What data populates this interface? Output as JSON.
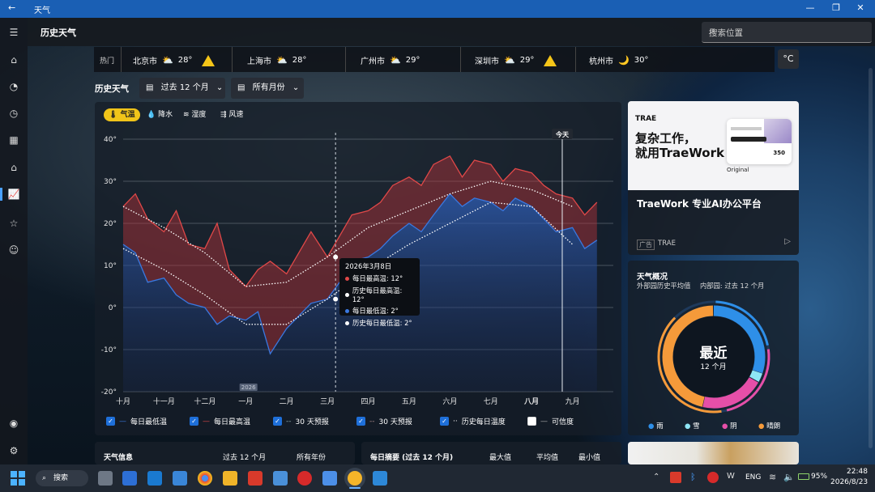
{
  "window": {
    "title": "天气",
    "controls": [
      "—",
      "❐",
      "✕"
    ]
  },
  "app": {
    "title": "历史天气",
    "search_placeholder": "搜索位置",
    "unit": "°C"
  },
  "nav_icons": [
    "menu-icon",
    "home-icon",
    "forecast-icon",
    "history-icon",
    "calendar-icon",
    "map-icon",
    "trend-chart-icon",
    "favorites-icon",
    "smiley-icon",
    "account-icon",
    "settings-icon"
  ],
  "hot_label": "热门",
  "cities": [
    {
      "name": "北京市",
      "temp": "28°",
      "icon": "⛅",
      "warn": true
    },
    {
      "name": "上海市",
      "temp": "28°",
      "icon": "⛅",
      "warn": false
    },
    {
      "name": "广州市",
      "temp": "29°",
      "icon": "⛅",
      "warn": false
    },
    {
      "name": "深圳市",
      "temp": "29°",
      "icon": "⛅",
      "warn": true
    },
    {
      "name": "杭州市",
      "temp": "30°",
      "icon": "🌙",
      "warn": false
    }
  ],
  "section_title": "历史天气",
  "filters": {
    "range": "过去 12 个月",
    "months": "所有月份"
  },
  "metric_tabs": [
    {
      "icon": "🌡",
      "label": "气温",
      "active": true
    },
    {
      "icon": "💧",
      "label": "降水",
      "active": false
    },
    {
      "icon": "≋",
      "label": "湿度",
      "active": false
    },
    {
      "icon": "⇶",
      "label": "风速",
      "active": false
    }
  ],
  "chart_data": {
    "type": "line",
    "yaxis": {
      "min": -20,
      "max": 40,
      "ticks": [
        "40°",
        "30°",
        "20°",
        "10°",
        "0°",
        "-10°",
        "-20°"
      ]
    },
    "x_labels": [
      "十月",
      "十一月",
      "十二月",
      "一月",
      "二月",
      "三月",
      "四月",
      "五月",
      "六月",
      "七月",
      "八月",
      "九月"
    ],
    "year_marker": "2026",
    "today_label": "今天",
    "series": [
      {
        "name": "历史每日最高温",
        "points": [
          [
            0,
            24
          ],
          [
            1,
            19
          ],
          [
            2,
            13
          ],
          [
            3,
            5
          ],
          [
            4,
            6
          ],
          [
            5,
            12
          ],
          [
            6,
            19
          ],
          [
            7,
            23
          ],
          [
            8,
            27
          ],
          [
            9,
            30
          ],
          [
            10,
            28
          ],
          [
            11,
            24
          ]
        ]
      },
      {
        "name": "历史每日最低温",
        "points": [
          [
            0,
            14
          ],
          [
            1,
            9
          ],
          [
            2,
            3
          ],
          [
            3,
            -4
          ],
          [
            4,
            -4
          ],
          [
            5,
            2
          ],
          [
            6,
            9
          ],
          [
            7,
            15
          ],
          [
            8,
            20
          ],
          [
            9,
            25
          ],
          [
            10,
            24
          ],
          [
            11,
            15
          ]
        ]
      },
      {
        "name": "每日最高温",
        "points": [
          [
            0,
            24
          ],
          [
            0.3,
            27
          ],
          [
            0.6,
            21
          ],
          [
            1,
            18
          ],
          [
            1.3,
            23
          ],
          [
            1.6,
            15
          ],
          [
            2,
            14
          ],
          [
            2.3,
            20
          ],
          [
            2.6,
            9
          ],
          [
            3,
            5
          ],
          [
            3.3,
            9
          ],
          [
            3.6,
            11
          ],
          [
            4,
            8
          ],
          [
            4.3,
            13
          ],
          [
            4.6,
            18
          ],
          [
            5,
            12
          ],
          [
            5.3,
            17
          ],
          [
            5.6,
            22
          ],
          [
            6,
            23
          ],
          [
            6.3,
            25
          ],
          [
            6.6,
            29
          ],
          [
            7,
            31
          ],
          [
            7.3,
            29
          ],
          [
            7.6,
            34
          ],
          [
            8,
            36
          ],
          [
            8.3,
            31
          ],
          [
            8.6,
            35
          ],
          [
            9,
            34
          ],
          [
            9.3,
            30
          ],
          [
            9.6,
            33
          ],
          [
            10,
            32
          ],
          [
            10.3,
            29
          ],
          [
            10.6,
            27
          ],
          [
            11,
            26
          ],
          [
            11.3,
            22
          ],
          [
            11.6,
            25
          ]
        ]
      },
      {
        "name": "每日最低温",
        "points": [
          [
            0,
            15
          ],
          [
            0.3,
            13
          ],
          [
            0.6,
            6
          ],
          [
            1,
            7
          ],
          [
            1.3,
            3
          ],
          [
            1.6,
            1
          ],
          [
            2,
            0
          ],
          [
            2.3,
            -4
          ],
          [
            2.6,
            -2
          ],
          [
            3,
            -3
          ],
          [
            3.3,
            -1
          ],
          [
            3.6,
            -11
          ],
          [
            4,
            -5
          ],
          [
            4.3,
            -2
          ],
          [
            4.6,
            1
          ],
          [
            5,
            2
          ],
          [
            5.3,
            6
          ],
          [
            5.6,
            11
          ],
          [
            6,
            12
          ],
          [
            6.3,
            14
          ],
          [
            6.6,
            17
          ],
          [
            7,
            20
          ],
          [
            7.3,
            18
          ],
          [
            7.6,
            22
          ],
          [
            8,
            27
          ],
          [
            8.3,
            24
          ],
          [
            8.6,
            26
          ],
          [
            9,
            25
          ],
          [
            9.3,
            23
          ],
          [
            9.6,
            26
          ],
          [
            10,
            24
          ],
          [
            10.3,
            21
          ],
          [
            10.6,
            18
          ],
          [
            11,
            19
          ],
          [
            11.3,
            14
          ],
          [
            11.6,
            16
          ]
        ]
      }
    ],
    "cursor_x": 5.2,
    "today_x": 10.75
  },
  "tooltip": {
    "date": "2026年3月8日",
    "lines": [
      {
        "color": "#e04848",
        "text": "每日最高温: 12°"
      },
      {
        "color": "#ffffff",
        "text": "历史每日最高温: 12°"
      },
      {
        "color": "#3a78e0",
        "text": "每日最低温: 2°"
      },
      {
        "color": "#ffffff",
        "text": "历史每日最低温: 2°"
      }
    ]
  },
  "legend": [
    {
      "label": "每日最低温",
      "checked": true
    },
    {
      "label": "每日最高温",
      "checked": true
    },
    {
      "label": "30 天预报",
      "checked": true
    },
    {
      "label": "30 天预报",
      "checked": true
    },
    {
      "label": "历史每日温度",
      "checked": true
    },
    {
      "label": "可信度",
      "checked": false
    }
  ],
  "ad": {
    "brand": "TRAE",
    "headline_1": "复杂工作，",
    "headline_2": "就用TraeWork",
    "mini": "Original",
    "mini_num": "350",
    "title": "TraeWork 专业AI办公平台",
    "tag": "广告",
    "source": "TRAE"
  },
  "overview": {
    "title": "天气概况",
    "sub_left": "外部园历史平均值",
    "sub_right": "内部园: 过去 12 个月",
    "center": "最近",
    "center_sub": "12 个月",
    "legend": [
      {
        "label": "雨",
        "color": "#2e8fe8"
      },
      {
        "label": "雪",
        "color": "#8ee6f5"
      },
      {
        "label": "阴",
        "color": "#e54fa8"
      },
      {
        "label": "晴朗",
        "color": "#f59a3a"
      }
    ]
  },
  "bottom": {
    "info_title": "天气信息",
    "info_col2": "过去 12 个月",
    "info_col3": "所有年份",
    "summary_title": "每日摘要 (过去 12 个月)",
    "col_max": "最大值",
    "col_avg": "平均值",
    "col_min": "最小值"
  },
  "taskbar": {
    "search": "搜索",
    "time": "22:48",
    "date": "2026/8/23",
    "lang": "ENG",
    "battery": "95%"
  }
}
